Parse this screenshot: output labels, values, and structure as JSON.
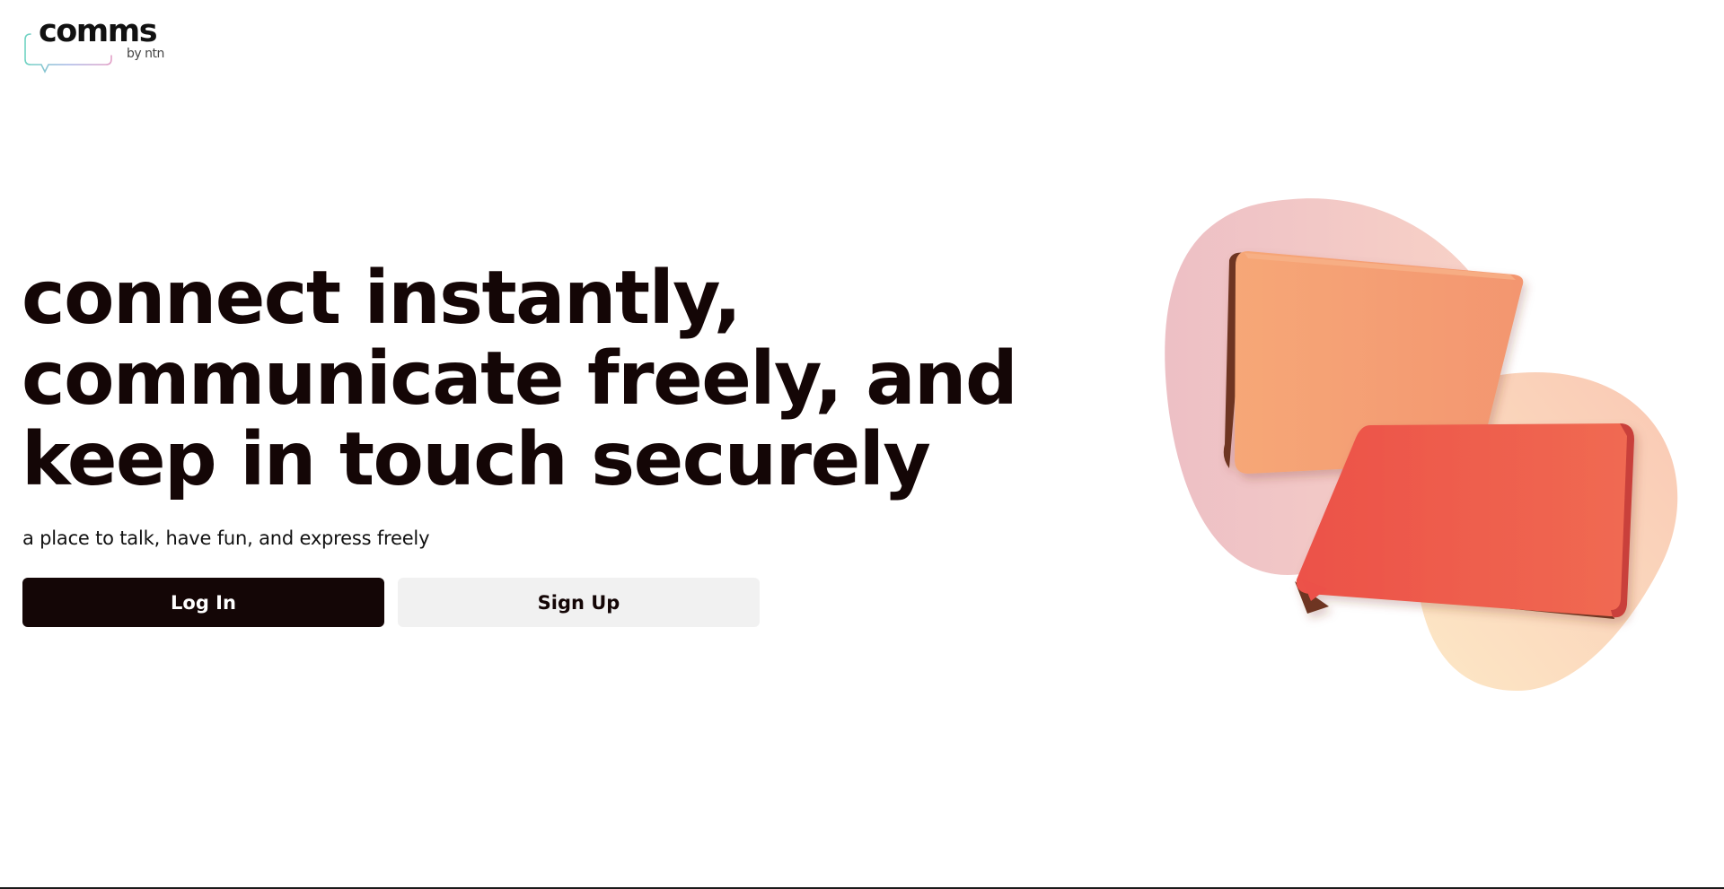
{
  "brand": {
    "name": "comms",
    "byline": "by ntn"
  },
  "hero": {
    "headline_lines": [
      "connect instantly,",
      "communicate freely, and",
      "keep in touch securely"
    ],
    "tagline": "a place to talk, have fun, and express freely"
  },
  "actions": {
    "login_label": "Log In",
    "signup_label": "Sign Up"
  },
  "colors": {
    "text_primary": "#140606",
    "login_bg": "#140606",
    "signup_bg": "#f1f1f1",
    "bubble_orange": "#f5a070",
    "bubble_red": "#ee5a4e",
    "blob_pink": "#f3c4c0",
    "blob_peach": "#fcd2b8"
  },
  "icons": {
    "logo_mark": "speech-bubble-outline-icon",
    "illustration": "chat-bubbles-illustration"
  }
}
